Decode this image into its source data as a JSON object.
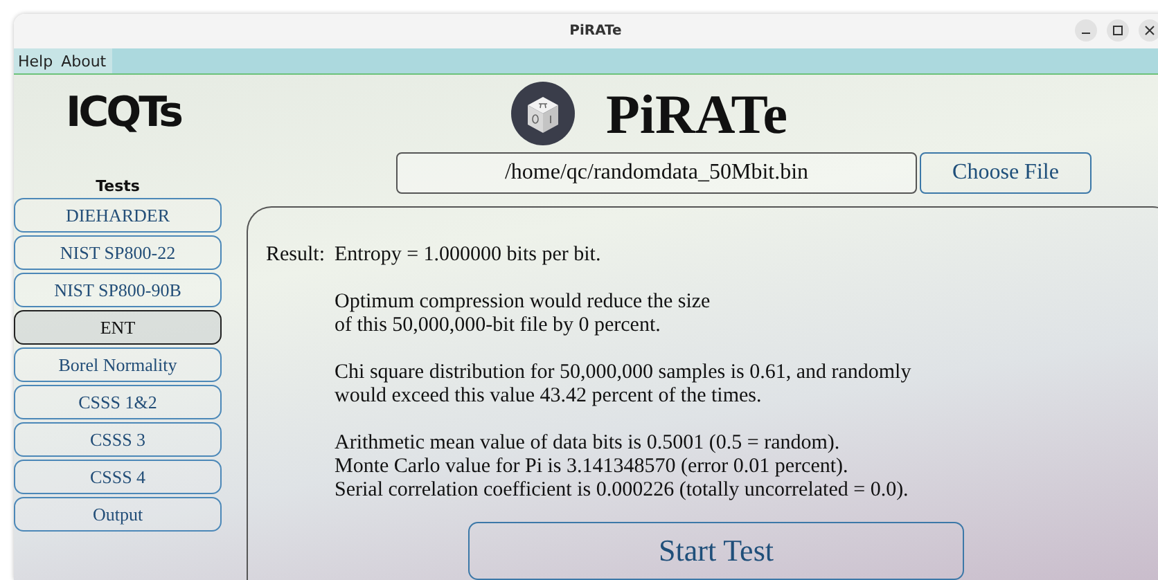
{
  "window": {
    "title": "PiRATe"
  },
  "menu": [
    "Help",
    "About"
  ],
  "logo": {
    "text": "ICQTs"
  },
  "app_title": "PiRATe",
  "file": {
    "value": "/home/qc/randomdata_50Mbit.bin",
    "button": "Choose File"
  },
  "sidebar": {
    "heading": "Tests",
    "items": [
      {
        "label": "DIEHARDER",
        "selected": false
      },
      {
        "label": "NIST SP800-22",
        "selected": false
      },
      {
        "label": "NIST SP800-90B",
        "selected": false
      },
      {
        "label": "ENT",
        "selected": true
      },
      {
        "label": "Borel Normality",
        "selected": false
      },
      {
        "label": "CSSS 1&2",
        "selected": false
      },
      {
        "label": "CSSS 3",
        "selected": false
      },
      {
        "label": "CSSS 4",
        "selected": false
      },
      {
        "label": "Output",
        "selected": false
      }
    ]
  },
  "result": {
    "label": "Result:",
    "paragraphs": [
      [
        "Entropy = 1.000000 bits per bit."
      ],
      [
        "Optimum compression would reduce the size",
        "of this 50,000,000-bit file by 0 percent."
      ],
      [
        "Chi square distribution for 50,000,000 samples is 0.61, and randomly",
        "would exceed this value 43.42 percent of the times."
      ],
      [
        "Arithmetic mean value of data bits is 0.5001 (0.5 = random).",
        "Monte Carlo value for Pi is 3.141348570 (error 0.01 percent).",
        "Serial correlation coefficient is 0.000226 (totally uncorrelated = 0.0)."
      ]
    ]
  },
  "start_button": "Start Test"
}
